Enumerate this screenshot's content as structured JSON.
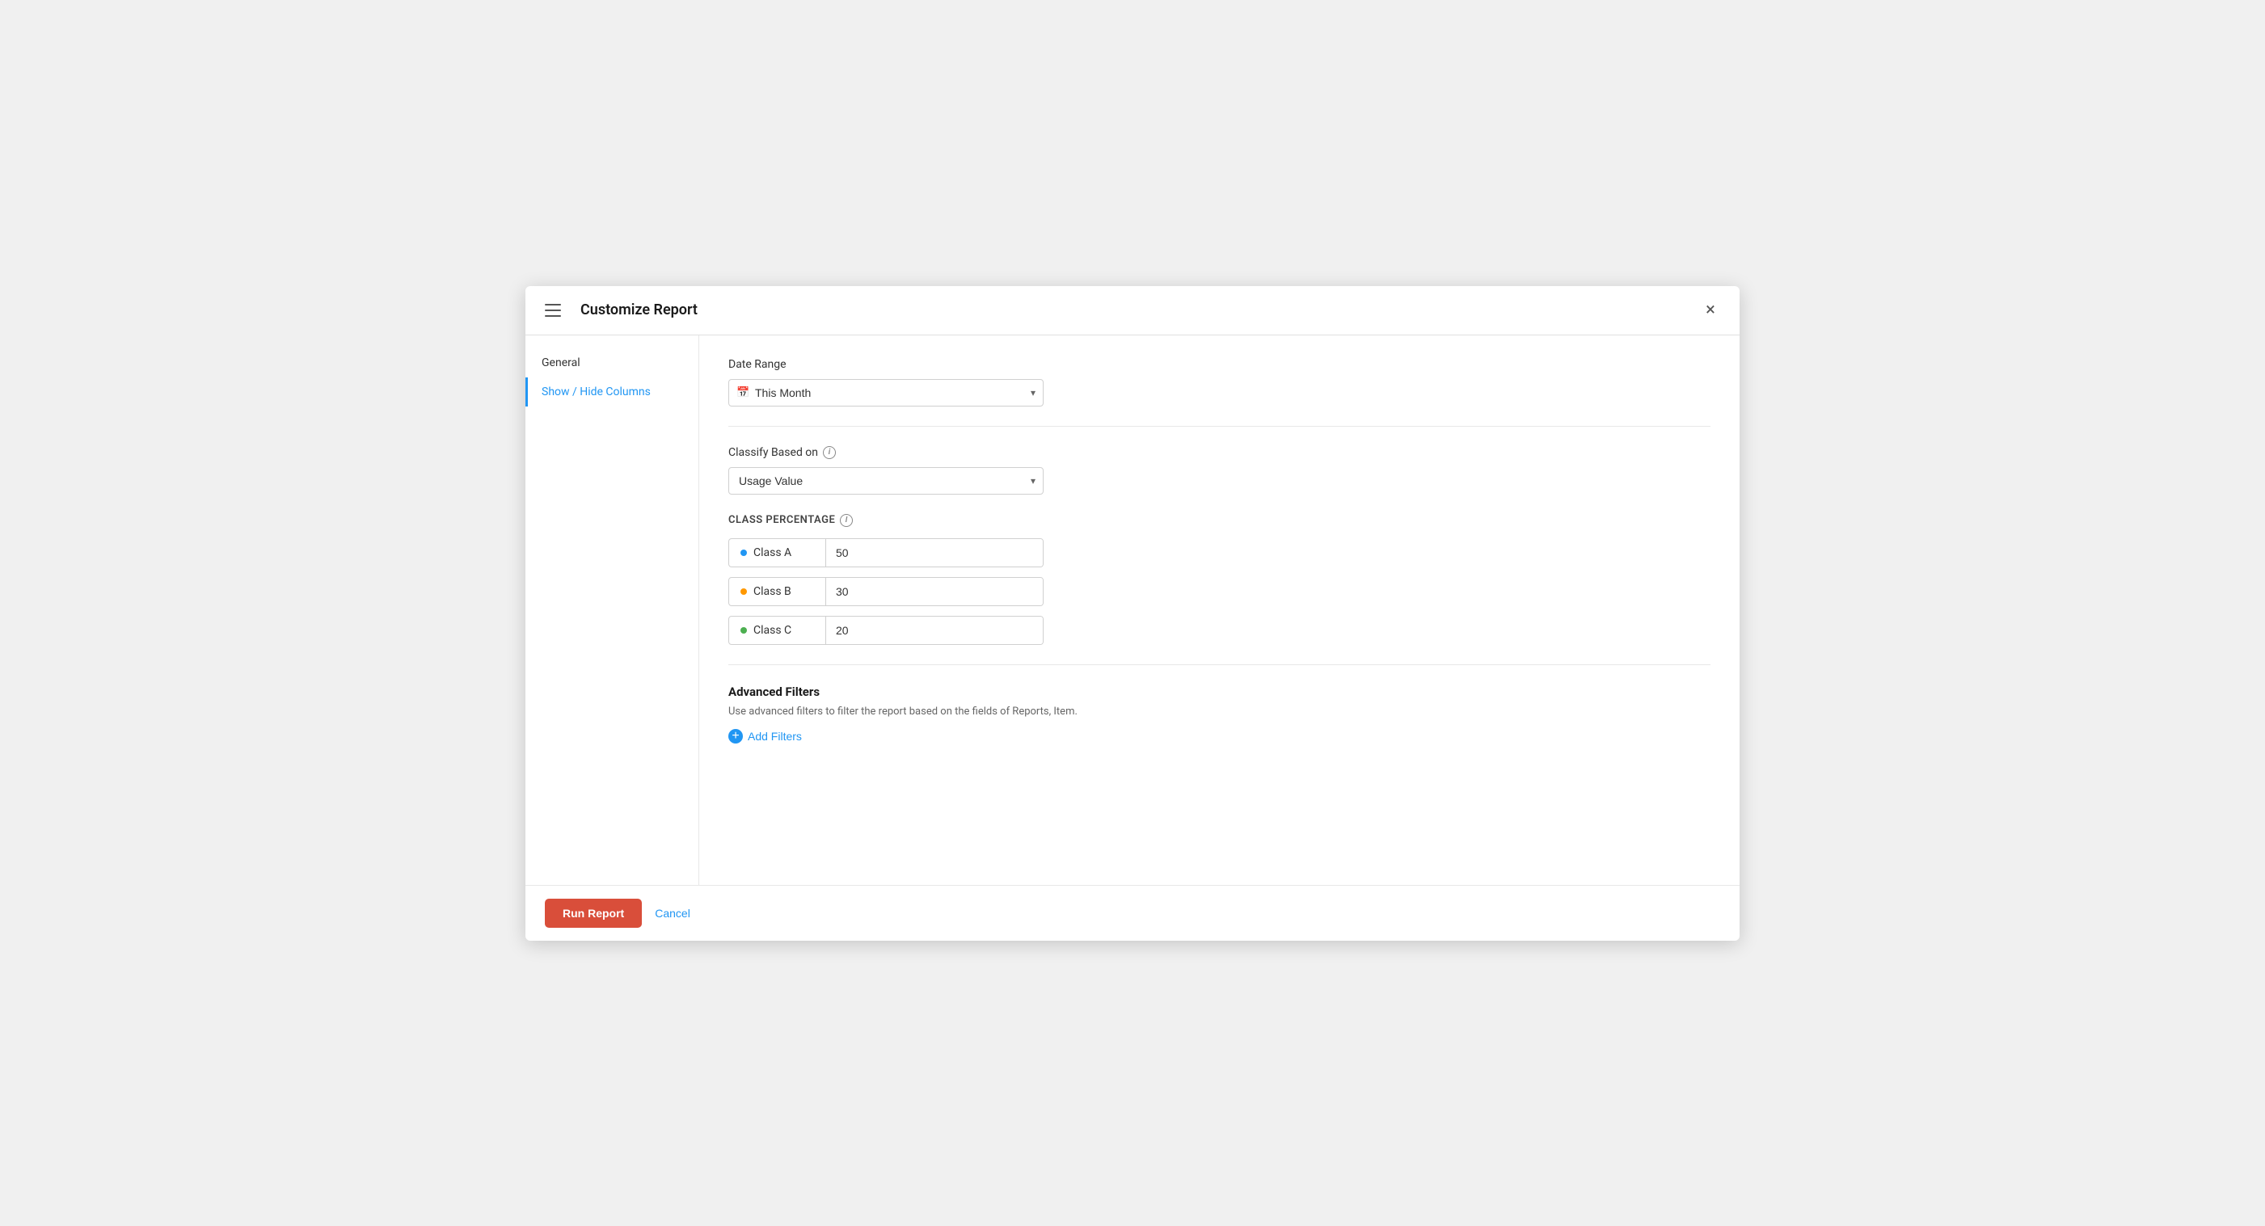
{
  "header": {
    "title": "Customize Report",
    "close_label": "×"
  },
  "sidebar": {
    "items": [
      {
        "id": "general",
        "label": "General",
        "active": false
      },
      {
        "id": "show-hide-columns",
        "label": "Show / Hide Columns",
        "active": true
      }
    ]
  },
  "content": {
    "date_range": {
      "label": "Date Range",
      "value": "This Month",
      "placeholder": "This Month"
    },
    "classify_based_on": {
      "label": "Classify Based on",
      "value": "Usage Value",
      "info_title": "Classify Based on info"
    },
    "class_percentage": {
      "section_label": "CLASS PERCENTAGE",
      "info_title": "Class Percentage info",
      "classes": [
        {
          "name": "Class A",
          "value": "50",
          "dot": "blue"
        },
        {
          "name": "Class B",
          "value": "30",
          "dot": "orange"
        },
        {
          "name": "Class C",
          "value": "20",
          "dot": "green"
        }
      ]
    },
    "advanced_filters": {
      "title": "Advanced Filters",
      "description": "Use advanced filters to filter the report based on the fields of Reports, Item.",
      "add_label": "Add Filters"
    }
  },
  "footer": {
    "run_label": "Run Report",
    "cancel_label": "Cancel"
  }
}
